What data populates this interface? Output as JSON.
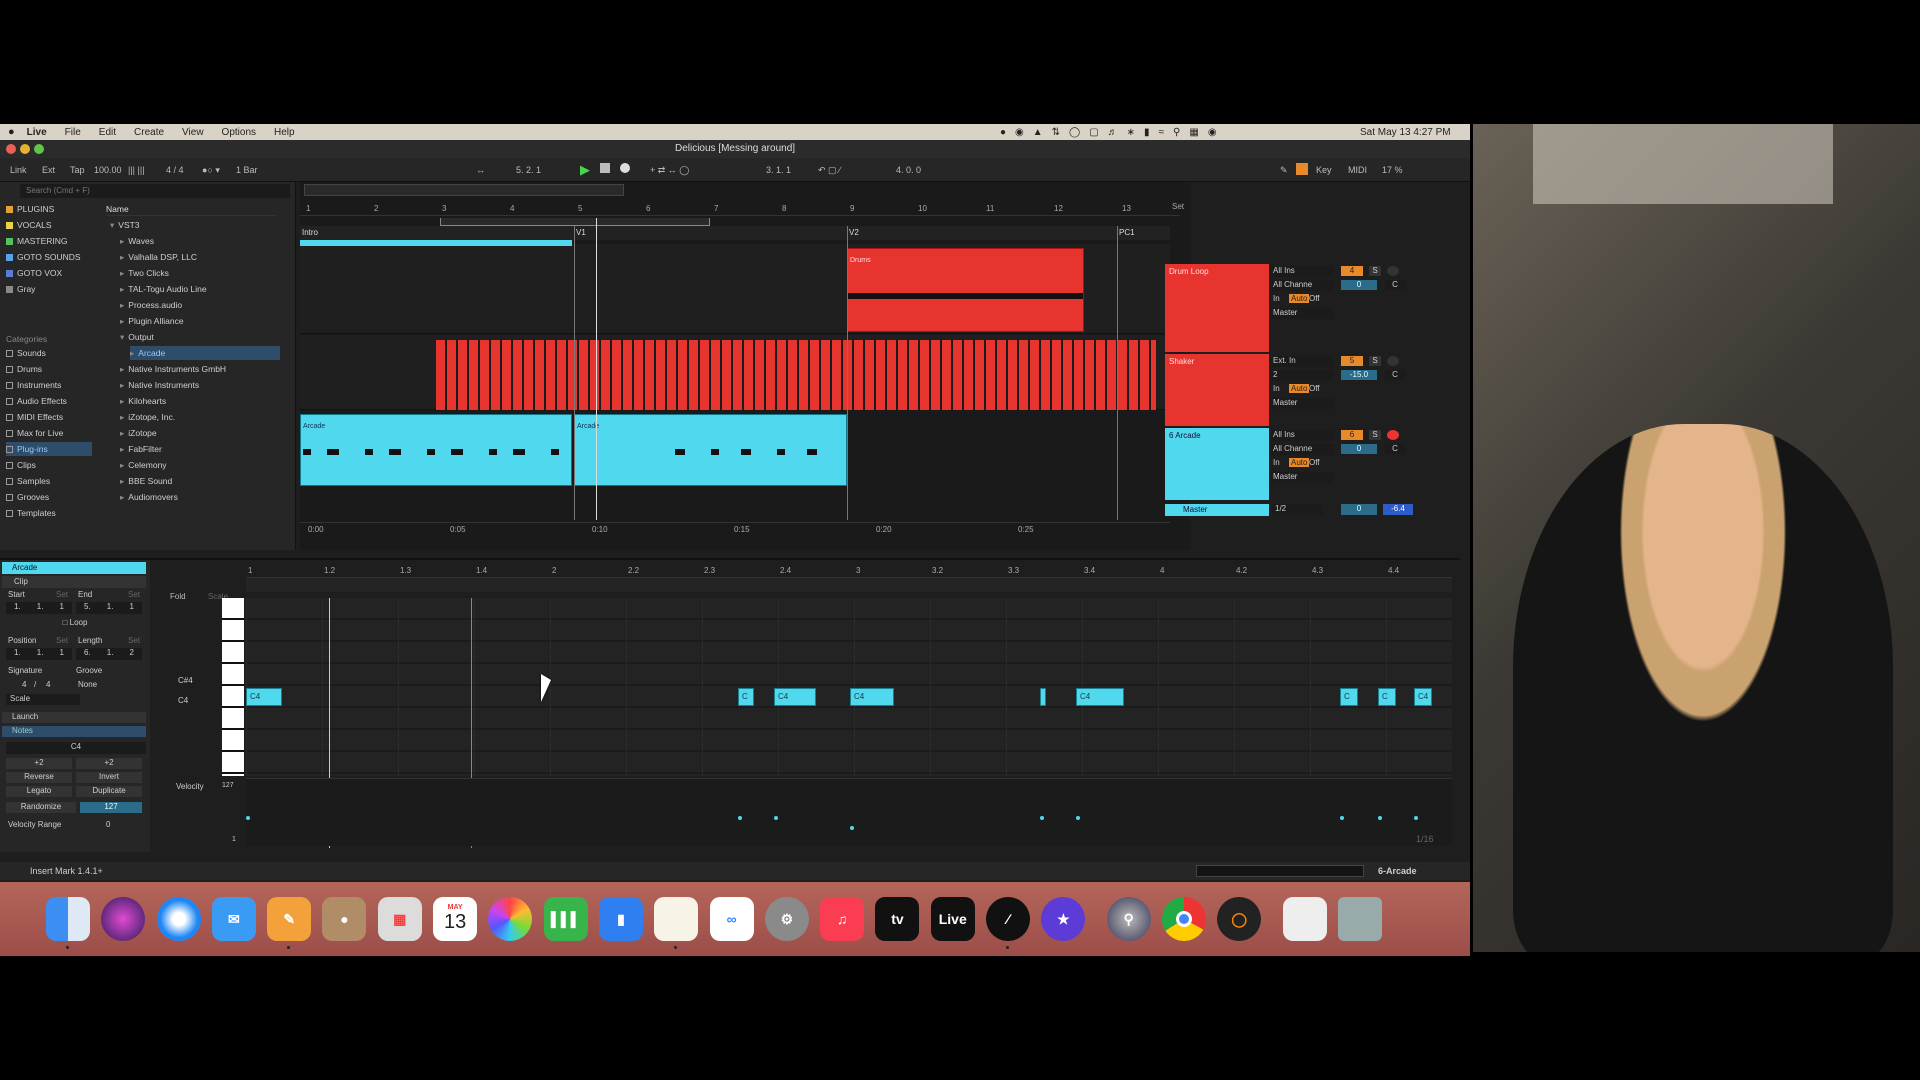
{
  "menubar": {
    "app": "Live",
    "items": [
      "File",
      "Edit",
      "Create",
      "View",
      "Options",
      "Help"
    ],
    "clock": "Sat May 13  4:27 PM"
  },
  "window": {
    "title": "Delicious  [Messing around]"
  },
  "transport": {
    "link": "Link",
    "ext": "Ext",
    "tap": "Tap",
    "tempo": "100.00",
    "signature": "4 / 4",
    "quant": "1 Bar",
    "position": "5.   2.   1",
    "loop_start": "3.   1.   1",
    "loop_length": "4.   0.   0",
    "key": "Key",
    "midi": "MIDI",
    "cpu": "17 %"
  },
  "browser": {
    "search_placeholder": "Search (Cmd + F)",
    "collections": [
      {
        "label": "PLUGINS",
        "color": "#e3a33b"
      },
      {
        "label": "VOCALS",
        "color": "#e7d24c"
      },
      {
        "label": "MASTERING",
        "color": "#56c25a"
      },
      {
        "label": "GOTO SOUNDS",
        "color": "#55a3e8"
      },
      {
        "label": "GOTO VOX",
        "color": "#5d7bd8"
      },
      {
        "label": "Gray",
        "color": "#8a8a8a"
      }
    ],
    "categories_header": "Categories",
    "categories": [
      "Sounds",
      "Drums",
      "Instruments",
      "Audio Effects",
      "MIDI Effects",
      "Max for Live",
      "Plug-ins",
      "Clips",
      "Samples",
      "Grooves",
      "Templates"
    ],
    "column_header": "Name",
    "tree": [
      "VST3",
      "Waves",
      "Valhalla DSP, LLC",
      "Two Clicks",
      "TAL-Togu Audio Line",
      "Process.audio",
      "Plugin Alliance",
      "Output",
      "Arcade",
      "Native Instruments GmbH",
      "Native Instruments",
      "Kilohearts",
      "iZotope, Inc.",
      "iZotope",
      "FabFilter",
      "Celemony",
      "BBE Sound",
      "Audiomovers"
    ]
  },
  "arrangement": {
    "bar_numbers": [
      "1",
      "2",
      "3",
      "4",
      "5",
      "6",
      "7",
      "8",
      "9",
      "10",
      "11",
      "12",
      "13"
    ],
    "locators": [
      "Intro",
      "V1",
      "V2",
      "PC1"
    ],
    "time_ticks": [
      "0:00",
      "0:05",
      "0:10",
      "0:15",
      "0:20",
      "0:25"
    ],
    "set_label": "Set",
    "clips": {
      "drums": "Drums",
      "arcade1": "Arcade",
      "arcade2": "Arcade"
    },
    "tracks": [
      {
        "name": "Drum Loop",
        "color": "#e8342e",
        "input": "All Ins",
        "channel": "All Channe",
        "monitor": [
          "In",
          "Auto",
          "Off"
        ],
        "output": "Master",
        "number": "4",
        "volume": "0",
        "pan": "C"
      },
      {
        "name": "Shaker",
        "color": "#e8342e",
        "input": "Ext. In",
        "channel": "2",
        "monitor": [
          "In",
          "Auto",
          "Off"
        ],
        "output": "Master",
        "number": "5",
        "volume": "-15.0",
        "pan": "C"
      },
      {
        "name": "6 Arcade",
        "color": "#4fd8ee",
        "input": "All Ins",
        "channel": "All Channe",
        "monitor": [
          "In",
          "Auto",
          "Off"
        ],
        "output": "Master",
        "number": "6",
        "volume": "0",
        "pan": "C"
      }
    ],
    "master": {
      "name": "Master",
      "cue": "1/2",
      "volume": "0",
      "peak": "-6.4"
    }
  },
  "clip_view": {
    "clip_name": "Arcade",
    "clip_section": "Clip",
    "start_label": "Start",
    "end_label": "End",
    "set": "Set",
    "start": [
      "1.",
      "1.",
      "1"
    ],
    "end": [
      "5.",
      "1.",
      "1"
    ],
    "loop": "Loop",
    "position_label": "Position",
    "length_label": "Length",
    "position": [
      "1.",
      "1.",
      "1"
    ],
    "length": [
      "6.",
      "1.",
      "2"
    ],
    "signature_label": "Signature",
    "groove_label": "Groove",
    "signature": [
      "4",
      "4"
    ],
    "groove": "None",
    "scale": "Scale",
    "launch": "Launch",
    "notes": "Notes",
    "note_name": "C4",
    "transpose": [
      "+2",
      "+2"
    ],
    "buttons": [
      "Reverse",
      "Invert",
      "Legato",
      "Duplicate"
    ],
    "randomize": "Randomize",
    "randomize_value": "127",
    "velocity_range": "Velocity Range",
    "velocity_range_value": "0"
  },
  "piano_roll": {
    "fold": "Fold",
    "scale": "Scale",
    "beat_ticks": [
      "1",
      "1.2",
      "1.3",
      "1.4",
      "2",
      "2.2",
      "2.3",
      "2.4",
      "3",
      "3.2",
      "3.3",
      "3.4",
      "4",
      "4.2",
      "4.3",
      "4.4"
    ],
    "key_labels": [
      "C#4",
      "C4"
    ],
    "notes": [
      "C4",
      "C",
      "C4",
      "C4",
      "",
      "C4",
      "C",
      "C",
      "C4"
    ],
    "velocity_label": "Velocity",
    "velocity_max": "127",
    "velocity_min": "1",
    "grid": "1/16"
  },
  "status": {
    "message": "Insert Mark 1.4.1+",
    "track": "6-Arcade"
  },
  "dock": {
    "calendar_month": "MAY",
    "calendar_day": "13",
    "live": "Live"
  }
}
